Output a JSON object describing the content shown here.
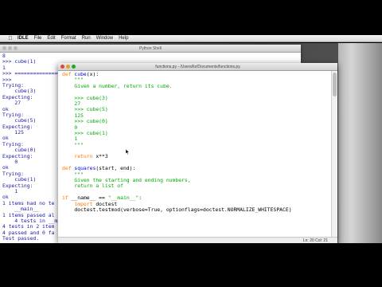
{
  "menubar": {
    "app_name": "IDLE",
    "items": [
      "File",
      "Edit",
      "Format",
      "Run",
      "Window",
      "Help"
    ]
  },
  "shell_window": {
    "title": "Python Shell",
    "lines": [
      "8",
      ">>> cube(1)",
      "1",
      ">>> ================================",
      ">>>",
      "Trying:",
      "    cube(3)",
      "Expecting:",
      "    27",
      "ok",
      "Trying:",
      "    cube(5)",
      "Expecting:",
      "    125",
      "ok",
      "Trying:",
      "    cube(0)",
      "Expecting:",
      "    0",
      "ok",
      "Trying:",
      "    cube(1)",
      "Expecting:",
      "    1",
      "ok",
      "1 items had no te",
      "    __main__",
      "1 items passed al",
      "    4 tests in __ma",
      "4 tests in 2 item",
      "4 passed and 0 fa",
      "Test passed.",
      ">>>"
    ]
  },
  "editor_window": {
    "title": "functions.py - /Users/liz/Documents/functions.py",
    "status": "Ln: 20 Col: 21",
    "lines": [
      [
        {
          "t": "def ",
          "c": "kw"
        },
        {
          "t": "cube",
          "c": "fn"
        },
        {
          "t": "(x):",
          "c": ""
        }
      ],
      [
        {
          "t": "    \"\"\"",
          "c": "str"
        }
      ],
      [
        {
          "t": "    Given a number, return its cube.",
          "c": "str"
        }
      ],
      [
        {
          "t": "",
          "c": ""
        }
      ],
      [
        {
          "t": "    >>> cube(3)",
          "c": "str"
        }
      ],
      [
        {
          "t": "    27",
          "c": "str"
        }
      ],
      [
        {
          "t": "    >>> cube(5)",
          "c": "str"
        }
      ],
      [
        {
          "t": "    125",
          "c": "str"
        }
      ],
      [
        {
          "t": "    >>> cube(0)",
          "c": "str"
        }
      ],
      [
        {
          "t": "    0",
          "c": "str"
        }
      ],
      [
        {
          "t": "    >>> cube(1)",
          "c": "str"
        }
      ],
      [
        {
          "t": "    1",
          "c": "str"
        }
      ],
      [
        {
          "t": "    \"\"\"",
          "c": "str"
        }
      ],
      [
        {
          "t": "",
          "c": ""
        }
      ],
      [
        {
          "t": "    ",
          "c": ""
        },
        {
          "t": "return",
          "c": "kw"
        },
        {
          "t": " x**3",
          "c": ""
        }
      ],
      [
        {
          "t": "",
          "c": ""
        }
      ],
      [
        {
          "t": "def ",
          "c": "kw"
        },
        {
          "t": "squares",
          "c": "fn"
        },
        {
          "t": "(start, end):",
          "c": ""
        }
      ],
      [
        {
          "t": "    \"\"\"",
          "c": "str"
        }
      ],
      [
        {
          "t": "    Given the starting and ending numbers,",
          "c": "str"
        }
      ],
      [
        {
          "t": "    return a list of",
          "c": "str"
        }
      ],
      [
        {
          "t": "",
          "c": ""
        }
      ],
      [
        {
          "t": "if",
          "c": "kw"
        },
        {
          "t": " __name__ == ",
          "c": ""
        },
        {
          "t": "\"__main__\"",
          "c": "str"
        },
        {
          "t": ":",
          "c": ""
        }
      ],
      [
        {
          "t": "    ",
          "c": ""
        },
        {
          "t": "import",
          "c": "kw"
        },
        {
          "t": " doctest",
          "c": ""
        }
      ],
      [
        {
          "t": "    doctest.testmod(verbose=True, optionflags=doctest.NORMALIZE_WHITESPACE)",
          "c": ""
        }
      ]
    ]
  },
  "colors": {
    "keyword": "#ff7700",
    "function_name": "#0000ff",
    "string": "#00aa00",
    "shell_output": "#1a1aa6"
  }
}
